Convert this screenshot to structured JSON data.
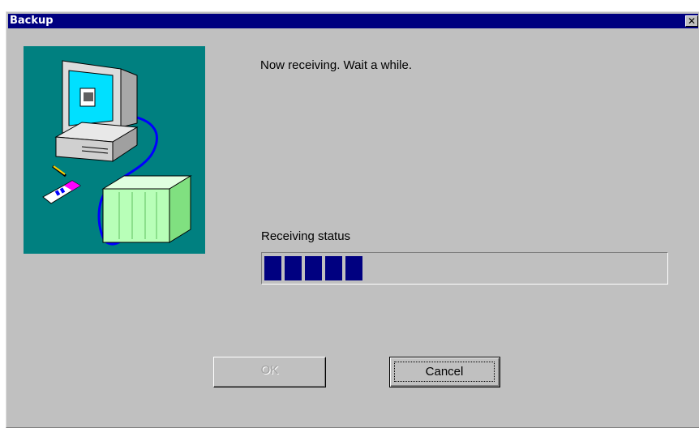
{
  "window": {
    "title": "Backup",
    "close_glyph": "✕"
  },
  "illustration": {
    "icon": "computer-to-plc-transfer-icon"
  },
  "message": "Now receiving. Wait a while.",
  "status": {
    "label": "Receiving status",
    "progress_fraction": 0.25,
    "fill_color": "#000080"
  },
  "buttons": {
    "ok_label": "OK",
    "ok_enabled": false,
    "cancel_label": "Cancel"
  },
  "colors": {
    "titlebar": "#000080",
    "dialog_bg": "#c0c0c0",
    "illustration_bg": "#008080"
  }
}
